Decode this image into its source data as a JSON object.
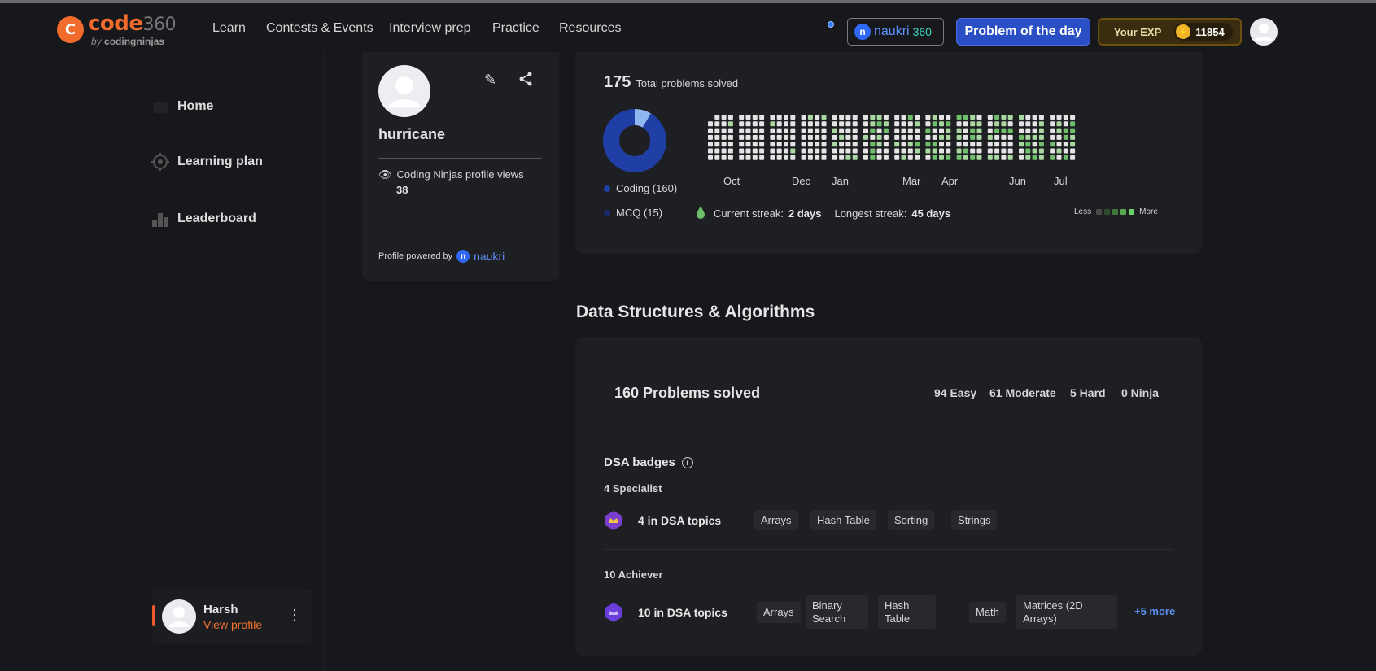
{
  "brand": {
    "mark": "C",
    "word": "code",
    "number": "360",
    "sub_by": "by",
    "sub_name": "codingninjas"
  },
  "nav": {
    "links": [
      "Learn",
      "Contests & Events",
      "Interview prep",
      "Practice",
      "Resources"
    ],
    "naukri": {
      "text": "naukri",
      "suffix": "360"
    },
    "potd_label": "Problem of the day",
    "exp_label": "Your EXP",
    "exp_value": "11854"
  },
  "sidebar": {
    "items": [
      {
        "label": "Home"
      },
      {
        "label": "Learning plan"
      },
      {
        "label": "Leaderboard"
      }
    ],
    "user": {
      "name": "Harsh",
      "link": "View profile"
    }
  },
  "profile": {
    "username": "hurricane",
    "views_label": "Coding Ninjas profile views",
    "views_count": "38",
    "powered_label": "Profile powered by",
    "powered_brand": "naukri"
  },
  "stats": {
    "total": "175",
    "total_label": "Total problems solved",
    "legend": [
      {
        "label": "Coding (160)",
        "color": "#1f3fa6",
        "value": 160
      },
      {
        "label": "MCQ (15)",
        "color": "#8fb7f0",
        "value": 15
      }
    ],
    "months": [
      "Oct",
      "Dec",
      "Jan",
      "Mar",
      "Apr",
      "Jun",
      "Jul"
    ],
    "current_streak_label": "Current streak:",
    "current_streak": "2 days",
    "longest_streak_label": "Longest streak:",
    "longest_streak": "45 days",
    "scale_less": "Less",
    "scale_more": "More",
    "heat_colors": [
      "#e4e4e4",
      "#a8d8a0",
      "#6fbf6a"
    ]
  },
  "dsa": {
    "title": "Data Structures & Algorithms",
    "solved": "160 Problems solved",
    "difficulty": [
      "94 Easy",
      "61 Moderate",
      "5 Hard",
      "0 Ninja"
    ],
    "badges_title": "DSA badges",
    "tiers": [
      {
        "name": "4 Specialist",
        "summary": "4 in DSA topics",
        "topics": [
          "Arrays",
          "Hash Table",
          "Sorting",
          "Strings"
        ]
      },
      {
        "name": "10 Achiever",
        "summary": "10 in DSA topics",
        "topics": [
          "Arrays",
          "Binary\nSearch",
          "Hash\nTable",
          "Math",
          "Matrices (2D\nArrays)"
        ],
        "more": "+5 more"
      }
    ]
  }
}
